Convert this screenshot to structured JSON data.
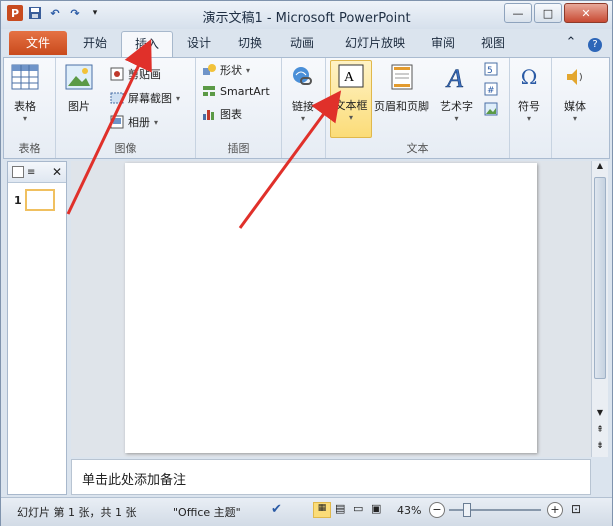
{
  "window": {
    "title": "演示文稿1 - Microsoft PowerPoint",
    "controls": {
      "minimize": "—",
      "maximize": "□",
      "close": "✕"
    }
  },
  "qat": {
    "logo": "P",
    "undo": "↶",
    "redo": "↷"
  },
  "tabs": [
    {
      "label": "文件"
    },
    {
      "label": "开始"
    },
    {
      "label": "插入"
    },
    {
      "label": "设计"
    },
    {
      "label": "切换"
    },
    {
      "label": "动画"
    },
    {
      "label": "幻灯片放映"
    },
    {
      "label": "审阅"
    },
    {
      "label": "视图"
    }
  ],
  "ribbon": {
    "groups": {
      "tables": {
        "label": "表格",
        "table_btn": "表格"
      },
      "images": {
        "label": "图像",
        "picture_btn": "图片",
        "clipart": "剪贴画",
        "screenshot": "屏幕截图",
        "album": "相册"
      },
      "illustrations": {
        "label": "插图",
        "shapes": "形状",
        "smartart": "SmartArt",
        "chart": "图表"
      },
      "links": {
        "label": "",
        "link_btn": "链接"
      },
      "text": {
        "label": "文本",
        "textbox_btn": "文本框",
        "header_btn": "页眉和页脚",
        "wordart_btn": "艺术字"
      },
      "symbols": {
        "symbol_btn": "符号"
      },
      "media": {
        "media_btn": "媒体"
      }
    }
  },
  "leftpane": {
    "slide_number": "1"
  },
  "notes": {
    "placeholder": "单击此处添加备注"
  },
  "status": {
    "slide_info": "幻灯片 第 1 张，共 1 张",
    "theme": "\"Office 主题\"",
    "zoom": "43%"
  },
  "colors": {
    "accent": "#c94a1c",
    "arrow": "#e0302a"
  }
}
